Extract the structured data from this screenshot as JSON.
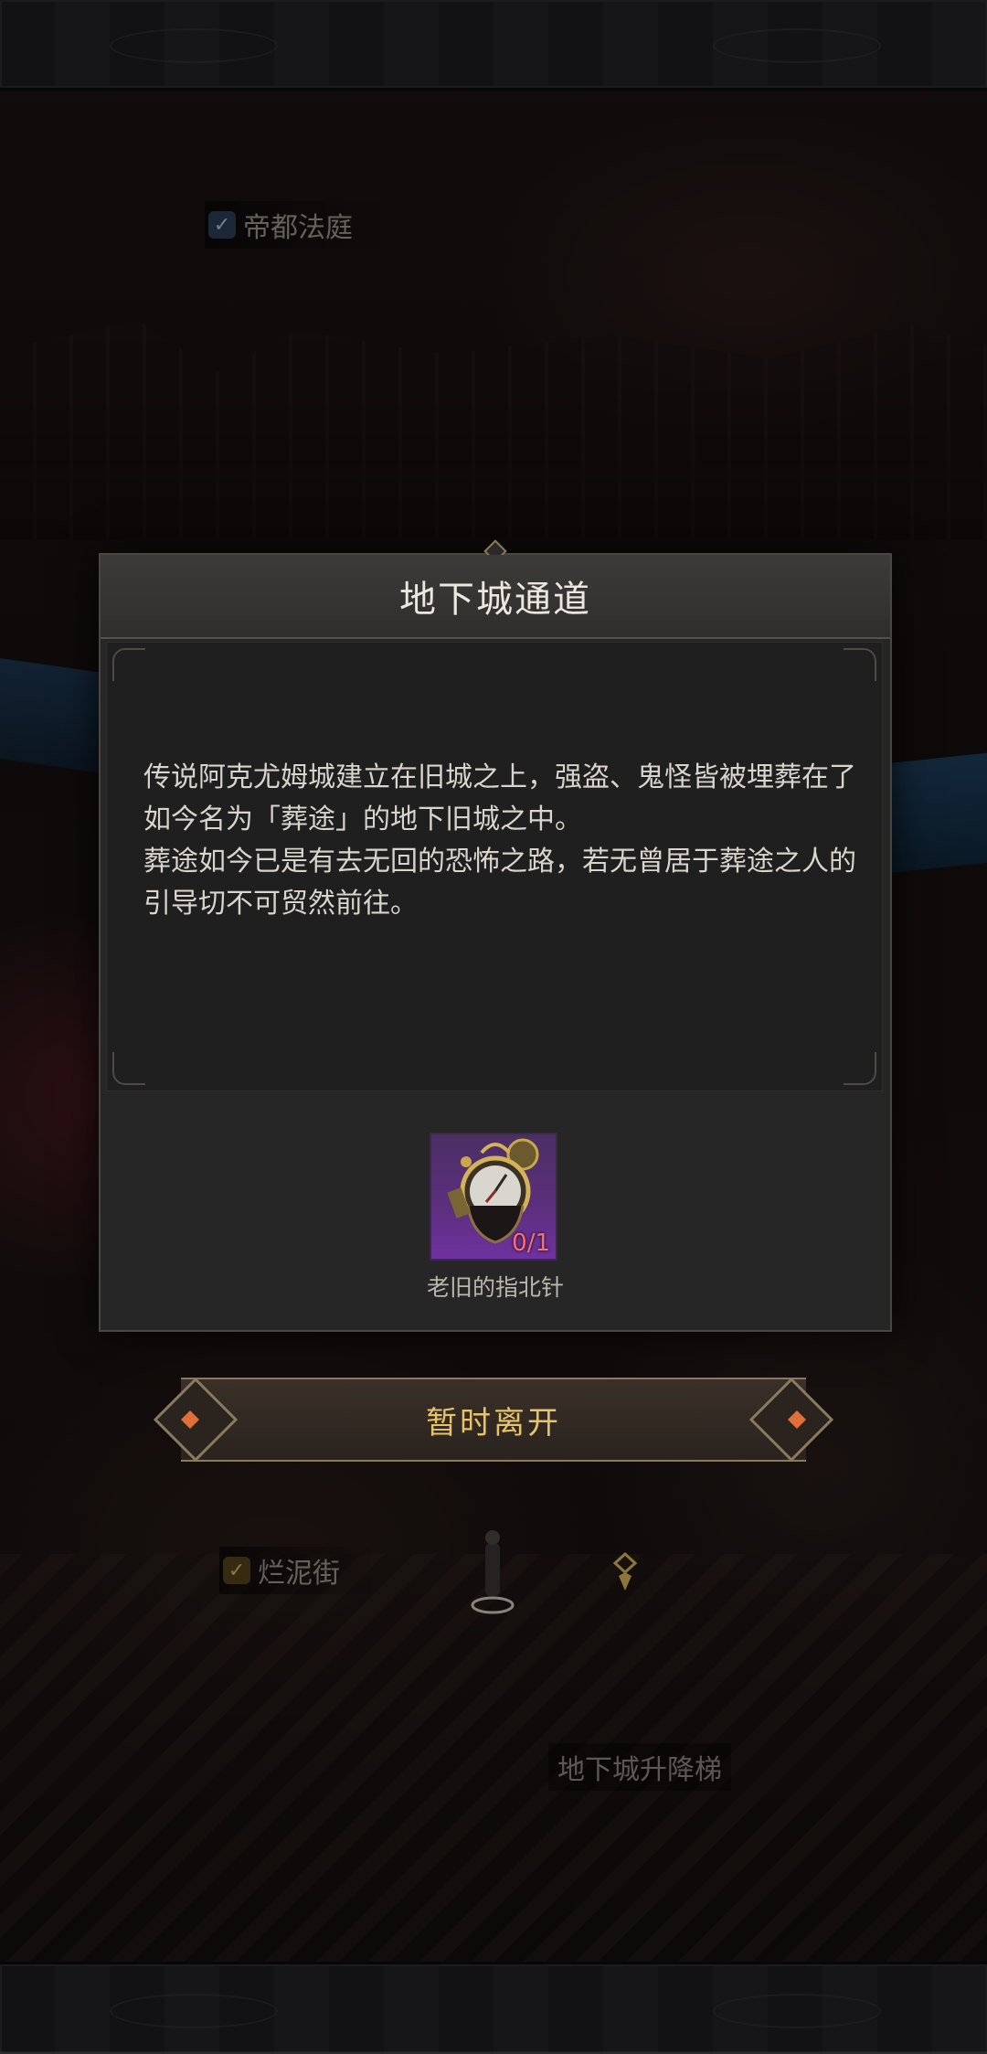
{
  "map": {
    "location_court": "帝都法庭",
    "location_mud_street": "烂泥街",
    "location_lift": "地下城升降梯"
  },
  "dialog": {
    "title": "地下城通道",
    "description": [
      "传说阿克尤姆城建立在旧城之上，强盗、鬼怪皆被埋葬在了如今名为「葬途」的地下旧城之中。",
      "葬途如今已是有去无回的恐怖之路，若无曾居于葬途之人的引导切不可贸然前往。"
    ],
    "required_item": {
      "name": "老旧的指北针",
      "count": "0/1",
      "icon": "old-compass-icon"
    },
    "leave_button": "暂时离开"
  },
  "colors": {
    "accent_gold": "#e8c468",
    "item_rarity_purple": "#5d2f7e",
    "count_red": "#ff6e6e"
  }
}
